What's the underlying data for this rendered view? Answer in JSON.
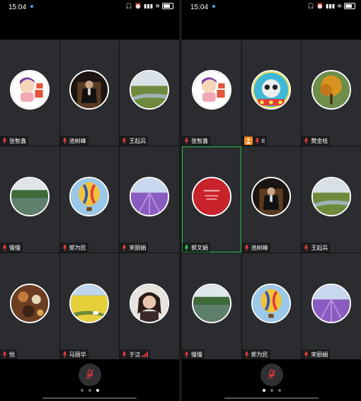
{
  "screens": [
    {
      "time": "15:04",
      "tiles": [
        {
          "name": "张智鑫",
          "avatar": "cartoon-boy"
        },
        {
          "name": "池树峰",
          "avatar": "man-in-chair"
        },
        {
          "name": "王起兵",
          "avatar": "river-landscape"
        },
        {
          "name": "慢慢",
          "avatar": "lake-landscape"
        },
        {
          "name": "郭为民",
          "avatar": "hot-air-balloon"
        },
        {
          "name": "宋丽娟",
          "avatar": "lavender-field"
        },
        {
          "name": "悦",
          "avatar": "spices-flatlay"
        },
        {
          "name": "马丽华",
          "avatar": "rapeseed-field"
        },
        {
          "name": "于洁",
          "avatar": "woman-portrait"
        }
      ],
      "page_dots": 3,
      "active_dot": 2
    },
    {
      "time": "15:04",
      "tiles": [
        {
          "name": "张智鑫",
          "avatar": "cartoon-boy"
        },
        {
          "name": "tt",
          "avatar": "panda-toy"
        },
        {
          "name": "樊金枝",
          "avatar": "autumn-tree"
        },
        {
          "name": "郭文娟",
          "avatar": "red-card"
        },
        {
          "name": "池树峰",
          "avatar": "man-in-chair"
        },
        {
          "name": "王起兵",
          "avatar": "river-landscape"
        },
        {
          "name": "慢慢",
          "avatar": "lake-landscape"
        },
        {
          "name": "郭为民",
          "avatar": "hot-air-balloon"
        },
        {
          "name": "宋丽娟",
          "avatar": "lavender-field"
        }
      ],
      "page_dots": 3,
      "active_dot": 0
    }
  ],
  "colors": {
    "tile_bg": "#2a2c2f",
    "active_speaker_border": "#2ecc55",
    "host_badge": "#f08a24",
    "muted_mic": "#e23b3b"
  }
}
